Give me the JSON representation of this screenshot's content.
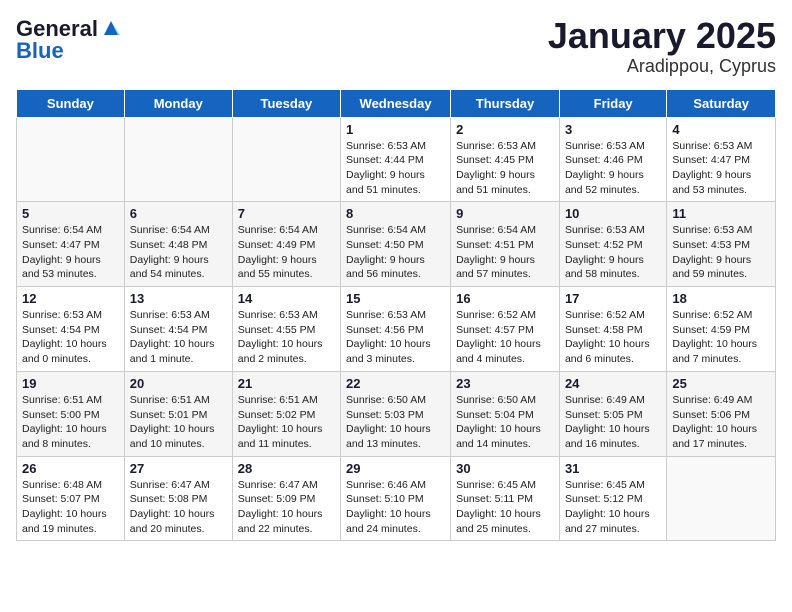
{
  "header": {
    "logo_general": "General",
    "logo_blue": "Blue",
    "title": "January 2025",
    "subtitle": "Aradippou, Cyprus"
  },
  "days_of_week": [
    "Sunday",
    "Monday",
    "Tuesday",
    "Wednesday",
    "Thursday",
    "Friday",
    "Saturday"
  ],
  "weeks": [
    [
      {
        "day": "",
        "info": ""
      },
      {
        "day": "",
        "info": ""
      },
      {
        "day": "",
        "info": ""
      },
      {
        "day": "1",
        "info": "Sunrise: 6:53 AM\nSunset: 4:44 PM\nDaylight: 9 hours\nand 51 minutes."
      },
      {
        "day": "2",
        "info": "Sunrise: 6:53 AM\nSunset: 4:45 PM\nDaylight: 9 hours\nand 51 minutes."
      },
      {
        "day": "3",
        "info": "Sunrise: 6:53 AM\nSunset: 4:46 PM\nDaylight: 9 hours\nand 52 minutes."
      },
      {
        "day": "4",
        "info": "Sunrise: 6:53 AM\nSunset: 4:47 PM\nDaylight: 9 hours\nand 53 minutes."
      }
    ],
    [
      {
        "day": "5",
        "info": "Sunrise: 6:54 AM\nSunset: 4:47 PM\nDaylight: 9 hours\nand 53 minutes."
      },
      {
        "day": "6",
        "info": "Sunrise: 6:54 AM\nSunset: 4:48 PM\nDaylight: 9 hours\nand 54 minutes."
      },
      {
        "day": "7",
        "info": "Sunrise: 6:54 AM\nSunset: 4:49 PM\nDaylight: 9 hours\nand 55 minutes."
      },
      {
        "day": "8",
        "info": "Sunrise: 6:54 AM\nSunset: 4:50 PM\nDaylight: 9 hours\nand 56 minutes."
      },
      {
        "day": "9",
        "info": "Sunrise: 6:54 AM\nSunset: 4:51 PM\nDaylight: 9 hours\nand 57 minutes."
      },
      {
        "day": "10",
        "info": "Sunrise: 6:53 AM\nSunset: 4:52 PM\nDaylight: 9 hours\nand 58 minutes."
      },
      {
        "day": "11",
        "info": "Sunrise: 6:53 AM\nSunset: 4:53 PM\nDaylight: 9 hours\nand 59 minutes."
      }
    ],
    [
      {
        "day": "12",
        "info": "Sunrise: 6:53 AM\nSunset: 4:54 PM\nDaylight: 10 hours\nand 0 minutes."
      },
      {
        "day": "13",
        "info": "Sunrise: 6:53 AM\nSunset: 4:54 PM\nDaylight: 10 hours\nand 1 minute."
      },
      {
        "day": "14",
        "info": "Sunrise: 6:53 AM\nSunset: 4:55 PM\nDaylight: 10 hours\nand 2 minutes."
      },
      {
        "day": "15",
        "info": "Sunrise: 6:53 AM\nSunset: 4:56 PM\nDaylight: 10 hours\nand 3 minutes."
      },
      {
        "day": "16",
        "info": "Sunrise: 6:52 AM\nSunset: 4:57 PM\nDaylight: 10 hours\nand 4 minutes."
      },
      {
        "day": "17",
        "info": "Sunrise: 6:52 AM\nSunset: 4:58 PM\nDaylight: 10 hours\nand 6 minutes."
      },
      {
        "day": "18",
        "info": "Sunrise: 6:52 AM\nSunset: 4:59 PM\nDaylight: 10 hours\nand 7 minutes."
      }
    ],
    [
      {
        "day": "19",
        "info": "Sunrise: 6:51 AM\nSunset: 5:00 PM\nDaylight: 10 hours\nand 8 minutes."
      },
      {
        "day": "20",
        "info": "Sunrise: 6:51 AM\nSunset: 5:01 PM\nDaylight: 10 hours\nand 10 minutes."
      },
      {
        "day": "21",
        "info": "Sunrise: 6:51 AM\nSunset: 5:02 PM\nDaylight: 10 hours\nand 11 minutes."
      },
      {
        "day": "22",
        "info": "Sunrise: 6:50 AM\nSunset: 5:03 PM\nDaylight: 10 hours\nand 13 minutes."
      },
      {
        "day": "23",
        "info": "Sunrise: 6:50 AM\nSunset: 5:04 PM\nDaylight: 10 hours\nand 14 minutes."
      },
      {
        "day": "24",
        "info": "Sunrise: 6:49 AM\nSunset: 5:05 PM\nDaylight: 10 hours\nand 16 minutes."
      },
      {
        "day": "25",
        "info": "Sunrise: 6:49 AM\nSunset: 5:06 PM\nDaylight: 10 hours\nand 17 minutes."
      }
    ],
    [
      {
        "day": "26",
        "info": "Sunrise: 6:48 AM\nSunset: 5:07 PM\nDaylight: 10 hours\nand 19 minutes."
      },
      {
        "day": "27",
        "info": "Sunrise: 6:47 AM\nSunset: 5:08 PM\nDaylight: 10 hours\nand 20 minutes."
      },
      {
        "day": "28",
        "info": "Sunrise: 6:47 AM\nSunset: 5:09 PM\nDaylight: 10 hours\nand 22 minutes."
      },
      {
        "day": "29",
        "info": "Sunrise: 6:46 AM\nSunset: 5:10 PM\nDaylight: 10 hours\nand 24 minutes."
      },
      {
        "day": "30",
        "info": "Sunrise: 6:45 AM\nSunset: 5:11 PM\nDaylight: 10 hours\nand 25 minutes."
      },
      {
        "day": "31",
        "info": "Sunrise: 6:45 AM\nSunset: 5:12 PM\nDaylight: 10 hours\nand 27 minutes."
      },
      {
        "day": "",
        "info": ""
      }
    ]
  ]
}
